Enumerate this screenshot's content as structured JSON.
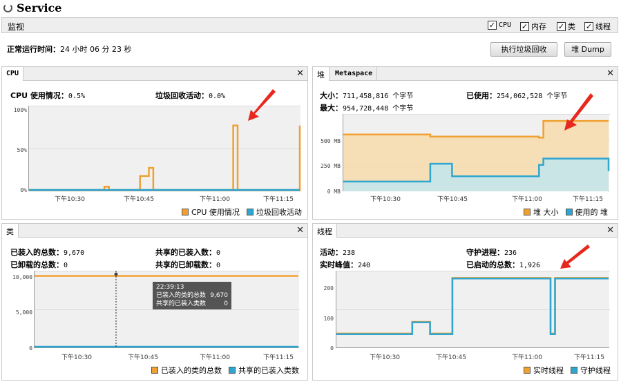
{
  "app": {
    "title": "Service"
  },
  "monitor": {
    "label": "监视",
    "checkboxes": [
      {
        "label": "CPU",
        "checked": true
      },
      {
        "label": "内存",
        "checked": true
      },
      {
        "label": "类",
        "checked": true
      },
      {
        "label": "线程",
        "checked": true
      }
    ],
    "check_mark": "✓",
    "uptime_label": "正常运行时间：",
    "uptime_value": "24 小时 06 分 23 秒",
    "gc_button": "执行垃圾回收",
    "heap_dump_button": "堆 Dump"
  },
  "colors": {
    "orange": "#f0a030",
    "blue": "#2ea6cf",
    "bg": "#f0f0f0"
  },
  "cpu": {
    "tab": "CPU",
    "close": "✕",
    "usage_label": "CPU 使用情况：",
    "usage_value": "0.5%",
    "gc_label": "垃圾回收活动：",
    "gc_value": "0.0%",
    "yticks": [
      "100%",
      "50%",
      "0%"
    ],
    "xticks": [
      "下午10:30",
      "下午10:45",
      "下午11:00",
      "下午11:15"
    ],
    "legend": [
      "CPU 使用情况",
      "垃圾回收活动"
    ]
  },
  "heap": {
    "tab_active": "堆",
    "tab_inactive": "Metaspace",
    "close": "✕",
    "size_label": "大小：",
    "size_value": "711,458,816 个字节",
    "max_label": "最大：",
    "max_value": "954,728,448 个字节",
    "used_label": "已使用：",
    "used_value": "254,062,528 个字节",
    "yticks": [
      "500 MB",
      "250 MB",
      "0 MB"
    ],
    "xticks": [
      "下午10:30",
      "下午10:45",
      "下午11:00",
      "下午11:15"
    ],
    "legend": [
      "堆 大小",
      "使用的 堆"
    ]
  },
  "classes": {
    "tab": "类",
    "close": "✕",
    "loaded_label": "已装入的总数：",
    "loaded_value": "9,670",
    "unloaded_label": "已卸载的总数：",
    "unloaded_value": "0",
    "shared_loaded_label": "共享的已装入数：",
    "shared_loaded_value": "0",
    "shared_unloaded_label": "共享的已卸载数：",
    "shared_unloaded_value": "0",
    "yticks": [
      "10,000",
      "5,000",
      "0"
    ],
    "xticks": [
      "下午10:30",
      "下午10:45",
      "下午11:00",
      "下午11:15"
    ],
    "legend": [
      "已装入的类的总数",
      "共享的已装入类数"
    ],
    "tooltip": {
      "time": "22:39:13",
      "row1_label": "已装入的类的总数",
      "row1_value": "9,670",
      "row2_label": "共享的已装入类数",
      "row2_value": "0"
    }
  },
  "threads": {
    "tab": "线程",
    "close": "✕",
    "live_label": "活动：",
    "live_value": "238",
    "peak_label": "实时峰值：",
    "peak_value": "240",
    "daemon_label": "守护进程：",
    "daemon_value": "236",
    "started_label": "已启动的总数：",
    "started_value": "1,926",
    "yticks": [
      "200",
      "100",
      "0"
    ],
    "xticks": [
      "下午10:30",
      "下午10:45",
      "下午11:00",
      "下午11:15"
    ],
    "legend": [
      "实时线程",
      "守护线程"
    ]
  },
  "chart_data": [
    {
      "type": "line",
      "title": "CPU",
      "x": [
        "22:20",
        "22:30",
        "22:37",
        "22:38",
        "22:45",
        "22:47",
        "22:48",
        "23:05",
        "23:06",
        "23:07",
        "23:20",
        "23:21"
      ],
      "ylim": [
        0,
        100
      ],
      "series": [
        {
          "name": "CPU 使用情况",
          "values": [
            0,
            0,
            4,
            0,
            17,
            27,
            0,
            0,
            79,
            0,
            0,
            79
          ]
        },
        {
          "name": "垃圾回收活动",
          "values": [
            0,
            0,
            0,
            0,
            0,
            0,
            0,
            0,
            0,
            0,
            0,
            0
          ]
        }
      ]
    },
    {
      "type": "area",
      "title": "堆",
      "x": [
        "22:20",
        "22:40",
        "22:45",
        "23:05",
        "23:06",
        "23:21"
      ],
      "ylim": [
        0,
        700
      ],
      "series": [
        {
          "name": "堆 大小",
          "values": [
            530,
            510,
            510,
            500,
            660,
            660
          ]
        },
        {
          "name": "使用的 堆",
          "values": [
            80,
            250,
            130,
            240,
            300,
            180
          ]
        }
      ]
    },
    {
      "type": "line",
      "title": "类",
      "x": [
        "22:20",
        "23:21"
      ],
      "ylim": [
        0,
        10000
      ],
      "series": [
        {
          "name": "已装入的类的总数",
          "values": [
            9670,
            9670
          ]
        },
        {
          "name": "共享的已装入类数",
          "values": [
            0,
            0
          ]
        }
      ]
    },
    {
      "type": "line",
      "title": "线程",
      "x": [
        "22:20",
        "22:36",
        "22:37",
        "22:41",
        "22:45",
        "22:46",
        "23:08",
        "23:09",
        "23:21"
      ],
      "ylim": [
        0,
        250
      ],
      "series": [
        {
          "name": "实时线程",
          "values": [
            45,
            45,
            85,
            45,
            45,
            235,
            45,
            235,
            235
          ]
        },
        {
          "name": "守护线程",
          "values": [
            43,
            43,
            83,
            43,
            43,
            233,
            43,
            233,
            233
          ]
        }
      ]
    }
  ]
}
